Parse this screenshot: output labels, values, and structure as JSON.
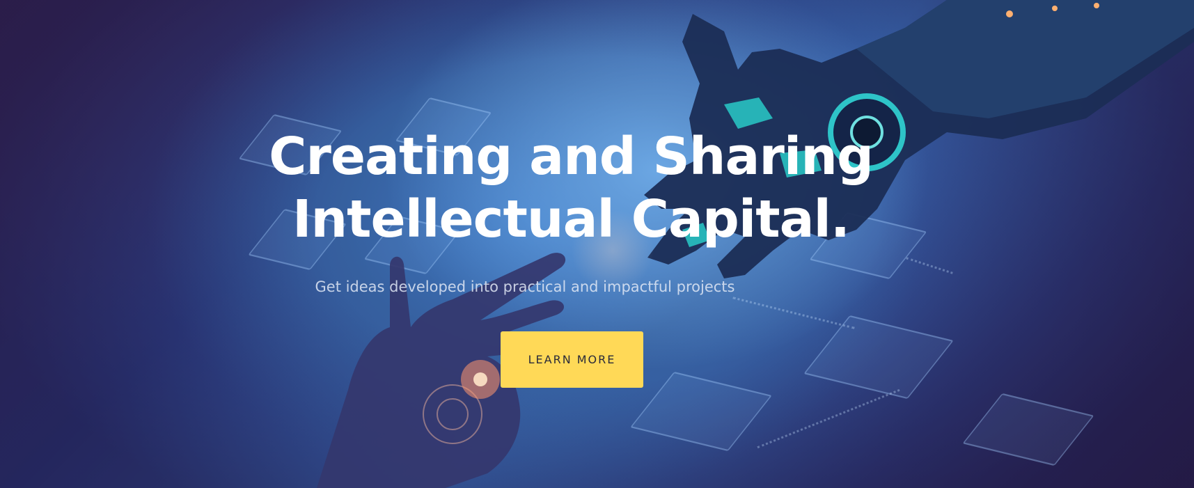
{
  "hero": {
    "title_line1": "Creating and Sharing",
    "title_line2": "Intellectual Capital.",
    "subtitle": "Get ideas developed into practical and impactful projects",
    "cta_label": "LEARN MORE"
  },
  "colors": {
    "cta_background": "#ffd957",
    "title_text": "#ffffff"
  }
}
